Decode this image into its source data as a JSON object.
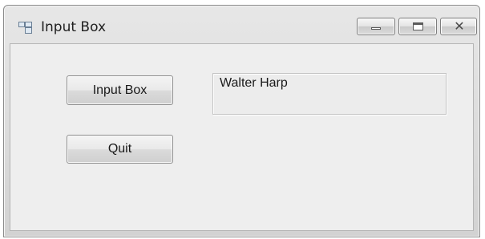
{
  "window": {
    "title": "Input Box"
  },
  "titlebar_controls": {
    "minimize_icon": "minimize-icon",
    "maximize_icon": "maximize-icon",
    "close_icon": "close-icon"
  },
  "form": {
    "input_box_button_label": "Input Box",
    "quit_button_label": "Quit",
    "result_label_text": "Walter Harp"
  },
  "colors": {
    "client_background": "#eeeeee",
    "window_frame": "#d2d2d2"
  }
}
